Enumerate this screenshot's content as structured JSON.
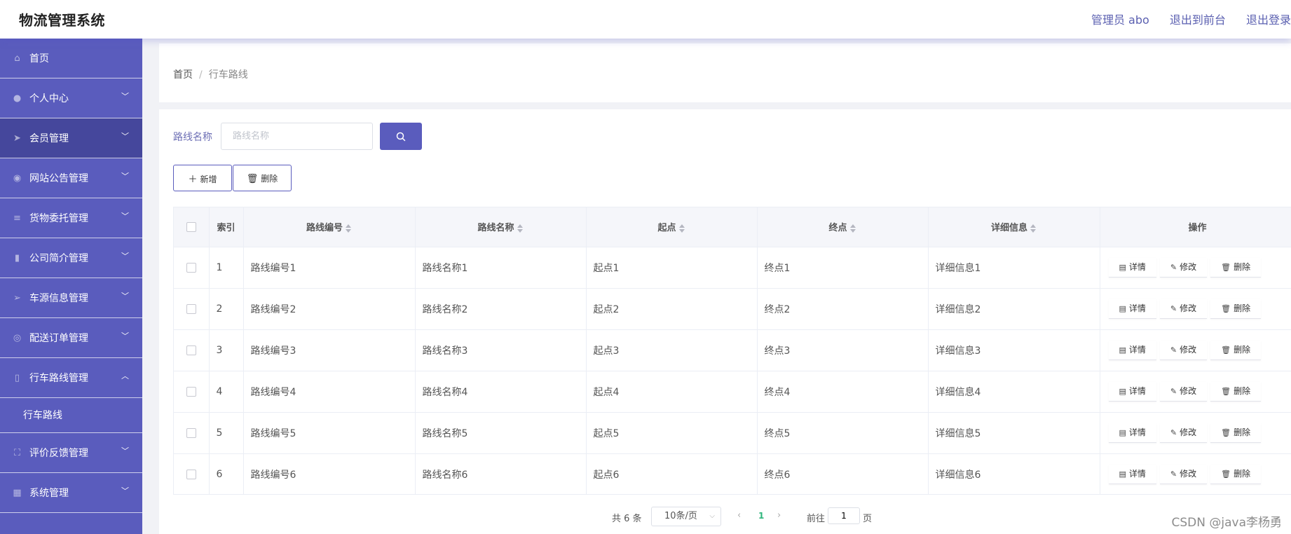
{
  "header": {
    "title": "物流管理系统",
    "user": "管理员 abo",
    "front_link": "退出到前台",
    "logout_link": "退出登录"
  },
  "sidebar": {
    "items": [
      {
        "label": "首页",
        "icon": "home-icon",
        "has_arrow": false,
        "active": false
      },
      {
        "label": "个人中心",
        "icon": "user-icon",
        "has_arrow": true,
        "active": false
      },
      {
        "label": "会员管理",
        "icon": "send-icon",
        "has_arrow": true,
        "active": true
      },
      {
        "label": "网站公告管理",
        "icon": "location-icon",
        "has_arrow": true,
        "active": false
      },
      {
        "label": "货物委托管理",
        "icon": "menu-icon",
        "has_arrow": true,
        "active": false
      },
      {
        "label": "公司简介管理",
        "icon": "chart-icon",
        "has_arrow": true,
        "active": false
      },
      {
        "label": "车源信息管理",
        "icon": "position-icon",
        "has_arrow": true,
        "active": false
      },
      {
        "label": "配送订单管理",
        "icon": "help-icon",
        "has_arrow": true,
        "active": false
      },
      {
        "label": "行车路线管理",
        "icon": "mic-icon",
        "has_arrow": true,
        "expanded": true,
        "active": false
      },
      {
        "label": "行车路线",
        "submenu": true
      },
      {
        "label": "评价反馈管理",
        "icon": "fullscreen-icon",
        "has_arrow": true,
        "active": false
      },
      {
        "label": "系统管理",
        "icon": "grid-icon",
        "has_arrow": true,
        "active": false
      }
    ]
  },
  "breadcrumb": {
    "home": "首页",
    "separator": "/",
    "current": "行车路线"
  },
  "search": {
    "label": "路线名称",
    "placeholder": "路线名称",
    "value": ""
  },
  "buttons": {
    "add": "新增",
    "delete": "删除"
  },
  "table": {
    "columns": [
      "索引",
      "路线编号",
      "路线名称",
      "起点",
      "终点",
      "详细信息",
      "操作"
    ],
    "rows": [
      {
        "index": "1",
        "code": "路线编号1",
        "name": "路线名称1",
        "start": "起点1",
        "end": "终点1",
        "detail": "详细信息1"
      },
      {
        "index": "2",
        "code": "路线编号2",
        "name": "路线名称2",
        "start": "起点2",
        "end": "终点2",
        "detail": "详细信息2"
      },
      {
        "index": "3",
        "code": "路线编号3",
        "name": "路线名称3",
        "start": "起点3",
        "end": "终点3",
        "detail": "详细信息3"
      },
      {
        "index": "4",
        "code": "路线编号4",
        "name": "路线名称4",
        "start": "起点4",
        "end": "终点4",
        "detail": "详细信息4"
      },
      {
        "index": "5",
        "code": "路线编号5",
        "name": "路线名称5",
        "start": "起点5",
        "end": "终点5",
        "detail": "详细信息5"
      },
      {
        "index": "6",
        "code": "路线编号6",
        "name": "路线名称6",
        "start": "起点6",
        "end": "终点6",
        "detail": "详细信息6"
      }
    ],
    "row_actions": [
      "详情",
      "修改",
      "删除"
    ]
  },
  "pagination": {
    "total": "共 6 条",
    "page_size": "10条/页",
    "current_page": "1",
    "goto_label": "前往",
    "goto_value": "1",
    "page_suffix": "页"
  },
  "watermark": "CSDN @java李杨勇",
  "colors": {
    "sidebar": "#5a5cbd",
    "sidebar_active": "#45479c",
    "accent": "#5a5cbd",
    "active_page": "#2fb57c"
  }
}
